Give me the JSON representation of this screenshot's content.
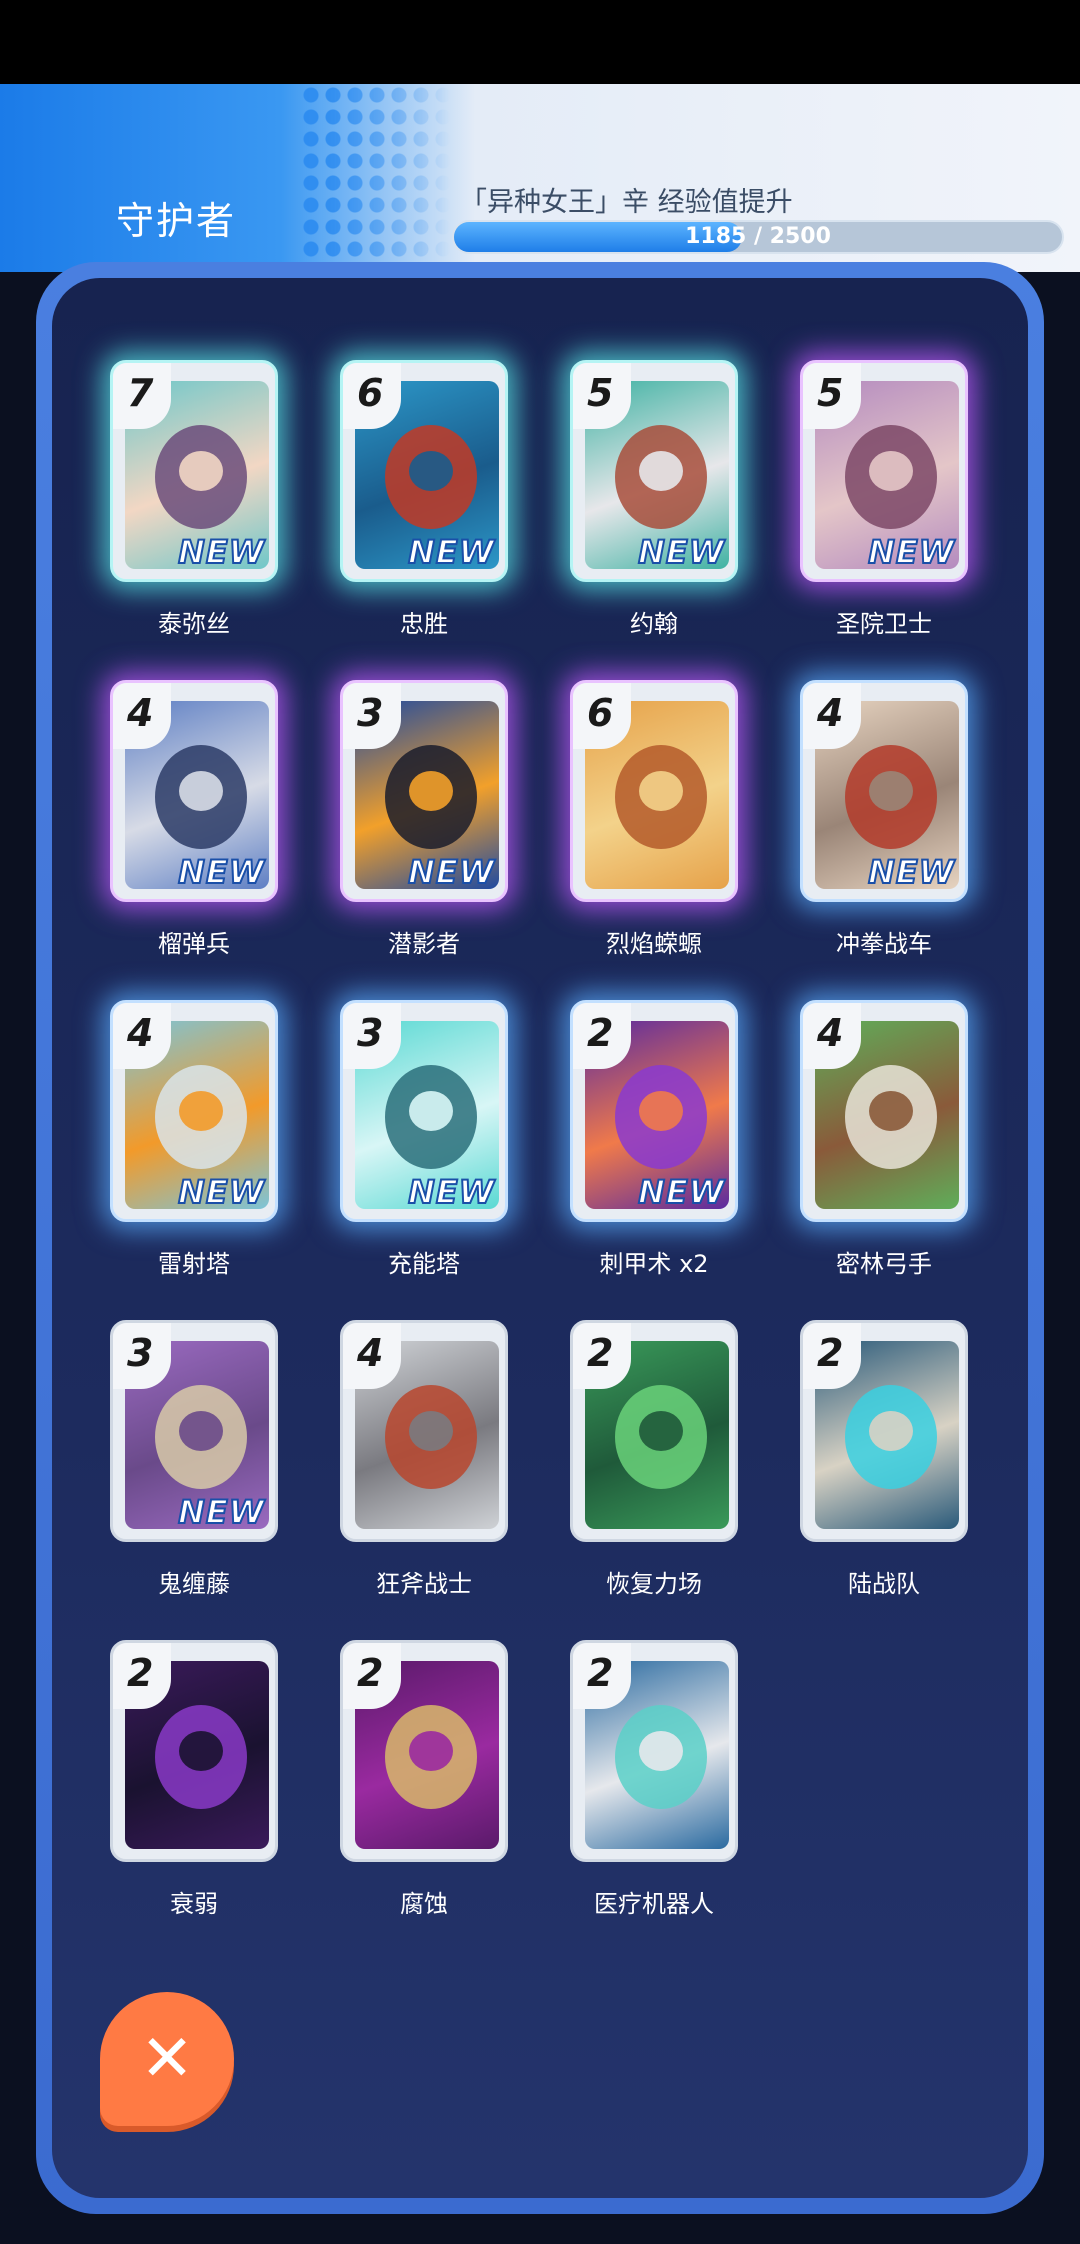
{
  "header": {
    "rank": "守护者",
    "hero_title": "「异种女王」辛 经验值提升",
    "xp_text": "1185 / 2500",
    "xp_fraction": 0.474
  },
  "cards": [
    {
      "cost": "7",
      "name": "泰弥丝",
      "new": "NEW",
      "glow": "cyan",
      "art": [
        "#6fc7c9",
        "#6b4c7a",
        "#f2d7c4"
      ]
    },
    {
      "cost": "6",
      "name": "忠胜",
      "new": "NEW",
      "glow": "cyan",
      "art": [
        "#2c97c8",
        "#c23a25",
        "#1a5c8c"
      ]
    },
    {
      "cost": "5",
      "name": "约翰",
      "new": "NEW",
      "glow": "cyan",
      "art": [
        "#3fb2a3",
        "#a84d3b",
        "#e7e7ea"
      ]
    },
    {
      "cost": "5",
      "name": "圣院卫士",
      "new": "NEW",
      "glow": "purple",
      "art": [
        "#b48bbf",
        "#7c4866",
        "#e4c6c8"
      ]
    },
    {
      "cost": "4",
      "name": "榴弹兵",
      "new": "NEW",
      "glow": "purple",
      "art": [
        "#5e7fc4",
        "#2c3b66",
        "#d7dbe6"
      ]
    },
    {
      "cost": "3",
      "name": "潜影者",
      "new": "NEW",
      "glow": "purple",
      "art": [
        "#1f4aa0",
        "#1a1c2c",
        "#f2a02a"
      ]
    },
    {
      "cost": "6",
      "name": "烈焰蝾螈",
      "new": "",
      "glow": "purple",
      "art": [
        "#e6a24a",
        "#b45a2a",
        "#f3d28a"
      ]
    },
    {
      "cost": "4",
      "name": "冲拳战车",
      "new": "NEW",
      "glow": "blue",
      "art": [
        "#e6d3c0",
        "#b33b2a",
        "#9a8577"
      ]
    },
    {
      "cost": "4",
      "name": "雷射塔",
      "new": "NEW",
      "glow": "blue",
      "art": [
        "#7cc4d8",
        "#d9e4ea",
        "#f29a2a"
      ]
    },
    {
      "cost": "3",
      "name": "充能塔",
      "new": "NEW",
      "glow": "blue",
      "art": [
        "#5ad9d3",
        "#2a6f7a",
        "#d8f6f6"
      ]
    },
    {
      "cost": "2",
      "name": "刺甲术 x2",
      "new": "NEW",
      "glow": "blue",
      "art": [
        "#5a2aa0",
        "#8a3ad0",
        "#f07a4a"
      ]
    },
    {
      "cost": "4",
      "name": "密林弓手",
      "new": "",
      "glow": "blue",
      "art": [
        "#5fae5a",
        "#e8e4d8",
        "#8a5a3a"
      ]
    },
    {
      "cost": "3",
      "name": "鬼缠藤",
      "new": "NEW",
      "glow": "none",
      "art": [
        "#9a6ac0",
        "#d8caa8",
        "#6a4a8a"
      ]
    },
    {
      "cost": "4",
      "name": "狂斧战士",
      "new": "",
      "glow": "none",
      "art": [
        "#cfd2d6",
        "#b8462e",
        "#7a7a80"
      ]
    },
    {
      "cost": "2",
      "name": "恢复力场",
      "new": "",
      "glow": "none",
      "art": [
        "#3a9a5a",
        "#6ad27a",
        "#1f5a3a"
      ]
    },
    {
      "cost": "2",
      "name": "陆战队",
      "new": "",
      "glow": "none",
      "art": [
        "#2a5a7a",
        "#3ad0e0",
        "#d8d2c4"
      ]
    },
    {
      "cost": "2",
      "name": "衰弱",
      "new": "",
      "glow": "none",
      "art": [
        "#3a1a5a",
        "#8a3ac8",
        "#1a1230"
      ]
    },
    {
      "cost": "2",
      "name": "腐蚀",
      "new": "",
      "glow": "none",
      "art": [
        "#5a1a6a",
        "#d8b86a",
        "#9a2aa0"
      ]
    },
    {
      "cost": "2",
      "name": "医疗机器人",
      "new": "",
      "glow": "none",
      "art": [
        "#2a6aa0",
        "#5ad0c8",
        "#e6e8ec"
      ]
    }
  ],
  "close_button": {
    "icon": "close-icon",
    "glyph": "✕"
  }
}
